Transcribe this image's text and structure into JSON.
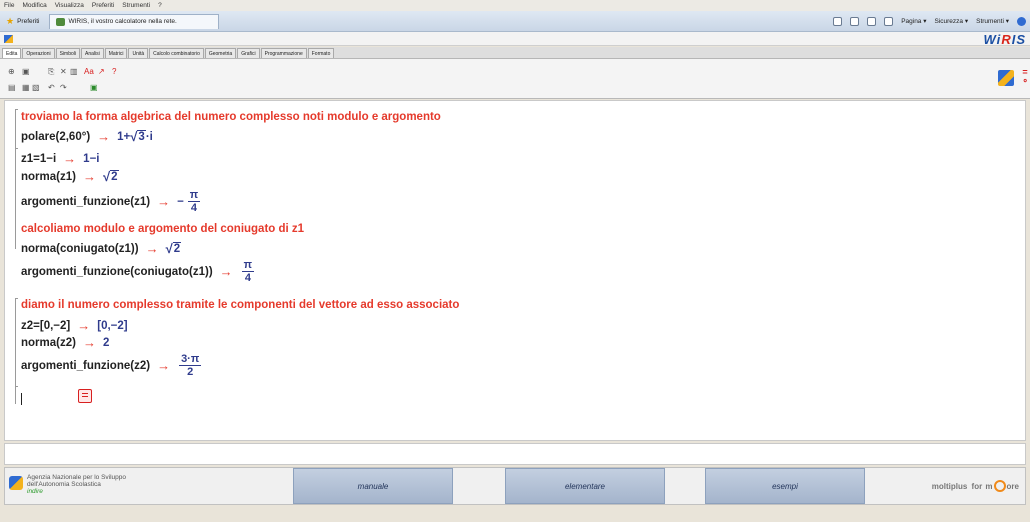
{
  "menubar": [
    "File",
    "Modifica",
    "Visualizza",
    "Preferiti",
    "Strumenti",
    "?"
  ],
  "favorites": {
    "label": "Preferiti",
    "tab_title": "WIRIS, il vostro calcolatore nella rete."
  },
  "ie_tools": [
    "Pagina ▾",
    "Sicurezza ▾",
    "Strumenti ▾"
  ],
  "wiris": {
    "logo_prefix": "Wi",
    "logo_r": "R",
    "logo_suffix": "IS"
  },
  "tabs": [
    "Edita",
    "Operazioni",
    "Simboli",
    "Analisi",
    "Matrici",
    "Unità",
    "Calcolo combinatorio",
    "Geometria",
    "Grafici",
    "Programmazione",
    "Formato"
  ],
  "doc": {
    "comment1": "troviamo la forma algebrica del numero complesso noti modulo e argomento",
    "polare_input": "polare(2,60°)",
    "polare_out_a": "1+",
    "polare_out_rad": "3",
    "polare_out_b": "·i",
    "z1_input": "z1=1−i",
    "z1_out": "1−i",
    "norma_input": "norma(z1)",
    "norma_out_rad": "2",
    "arg1_input": "argomenti_funzione(z1)",
    "arg1_sign": "−",
    "arg1_num": "π",
    "arg1_den": "4",
    "comment2": "calcoliamo modulo e argomento del coniugato di z1",
    "normc_input": "norma(coniugato(z1))",
    "normc_out_rad": "2",
    "argc_input": "argomenti_funzione(coniugato(z1))",
    "argc_num": "π",
    "argc_den": "4",
    "comment3": "diamo il numero complesso tramite le componenti del vettore ad esso associato",
    "z2_input": "z2=[0,−2]",
    "z2_out": "[0,−2]",
    "norm2_input": "norma(z2)",
    "norm2_out": "2",
    "arg2_input": "argomenti_funzione(z2)",
    "arg2_num": "3·π",
    "arg2_den": "2",
    "arrow": "→"
  },
  "footer": {
    "agency_l1": "Agenzia Nazionale per lo Sviluppo",
    "agency_l2": "dell'Autonomia Scolastica",
    "agency_l3": "indire",
    "btn_manuale": "manuale",
    "btn_elementare": "elementare",
    "btn_esempi": "esempi",
    "brand_a": "moltiplus",
    "brand_b": "for",
    "brand_c": "ore"
  },
  "colors": {
    "comment": "#e53a2c",
    "result": "#2f3b8c",
    "brand_blue": "#1b4fa3"
  }
}
